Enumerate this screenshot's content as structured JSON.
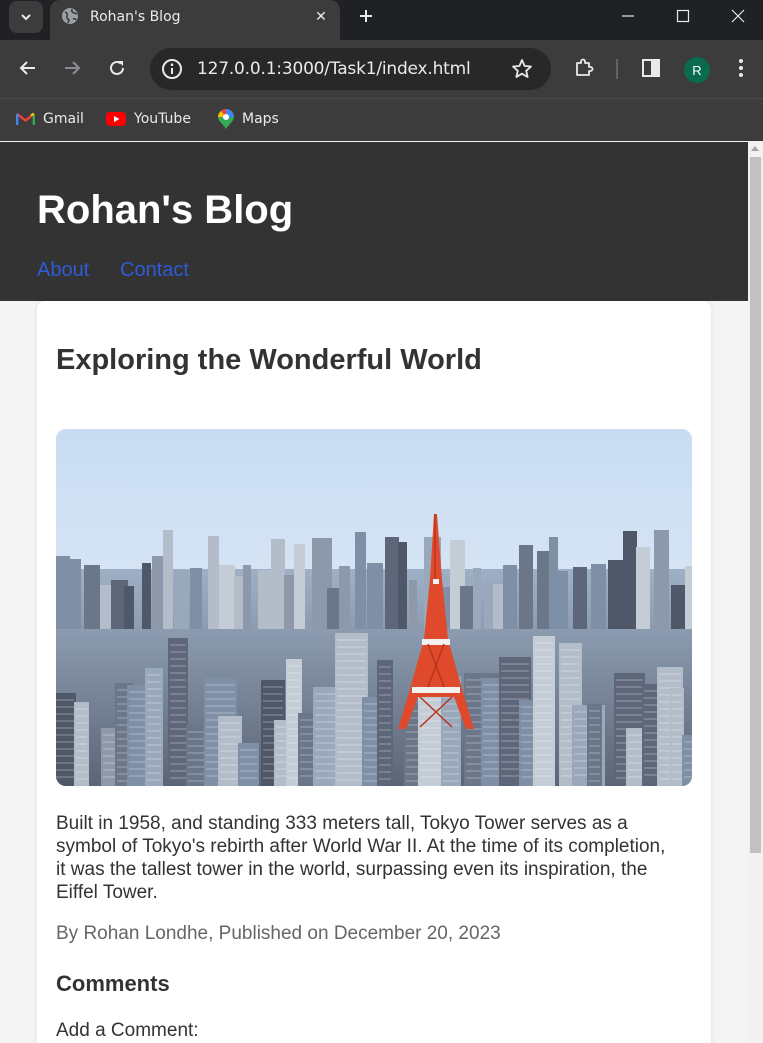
{
  "browser": {
    "tab": {
      "title": "Rohan's Blog",
      "close_glyph": "✕"
    },
    "new_tab_icon": "plus-icon",
    "address_bar": {
      "url": "127.0.0.1:3000/Task1/index.html"
    },
    "profile_initial": "R",
    "bookmarks": [
      {
        "label": "Gmail",
        "icon": "gmail-icon"
      },
      {
        "label": "YouTube",
        "icon": "youtube-icon"
      },
      {
        "label": "Maps",
        "icon": "maps-icon"
      }
    ],
    "colors": {
      "tabstrip": "#202124",
      "toolbar": "#3c3c3c",
      "omnibox": "#282828",
      "avatar": "#0b6b4f"
    }
  },
  "site": {
    "title": "Rohan's Blog",
    "nav": [
      {
        "label": "About"
      },
      {
        "label": "Contact"
      }
    ],
    "colors": {
      "header": "#333333",
      "link": "#2f5bd6",
      "page_bg": "#f4f4f4"
    }
  },
  "post": {
    "title": "Exploring the Wonderful World",
    "image_subject": "tokyo-skyline-with-tokyo-tower",
    "body": "Built in 1958, and standing 333 meters tall, Tokyo Tower serves as a symbol of Tokyo's rebirth after World War II. At the time of its completion, it was the tallest tower in the world, surpassing even its inspiration, the Eiffel Tower.",
    "meta": "By Rohan Londhe, Published on December 20, 2023"
  },
  "comments": {
    "heading": "Comments",
    "add_label": "Add a Comment:"
  }
}
